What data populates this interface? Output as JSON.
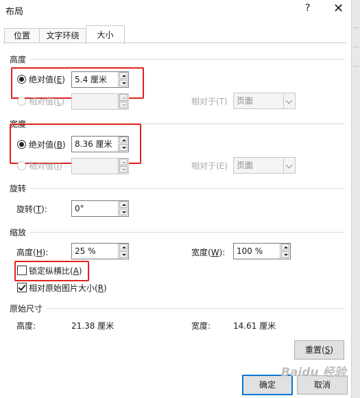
{
  "window": {
    "title": "布局",
    "help_label": "?",
    "close_label": "✕"
  },
  "tabs": [
    {
      "label": "位置"
    },
    {
      "label": "文字环绕"
    },
    {
      "label": "大小"
    }
  ],
  "height": {
    "section_title": "高度",
    "absolute_label": "绝对值(",
    "absolute_key": "E",
    "absolute_value": "5.4 厘米",
    "relative_label": "相对值(",
    "relative_key": "L",
    "relative_to_label": "相对于(T)",
    "relative_to_value": "页面"
  },
  "width": {
    "section_title": "宽度",
    "absolute_label": "绝对值(",
    "absolute_key": "B",
    "absolute_value": "8.36 厘米",
    "relative_label": "相对值(",
    "relative_key": "I",
    "relative_to_label": "相对于(E)",
    "relative_to_value": "页面"
  },
  "rotation": {
    "section_title": "旋转",
    "label": "旋转(",
    "key": "T",
    "value": "0°"
  },
  "scale": {
    "section_title": "缩放",
    "height_label": "高度(",
    "height_key": "H",
    "height_value": "25 %",
    "width_label": "宽度(",
    "width_key": "W",
    "width_value": "100 %",
    "lock_label": "锁定纵横比(",
    "lock_key": "A",
    "lock_checked": false,
    "relative_original_label": "相对原始图片大小(",
    "relative_original_key": "R",
    "relative_original_checked": true
  },
  "original_size": {
    "section_title": "原始尺寸",
    "height_label": "高度:",
    "height_value": "21.38 厘米",
    "width_label": "宽度:",
    "width_value": "14.61 厘米"
  },
  "buttons": {
    "reset_label": "重置(",
    "reset_key": "S",
    "ok_label": "确定",
    "cancel_label": "取消"
  },
  "watermark": "Baidu 经验"
}
